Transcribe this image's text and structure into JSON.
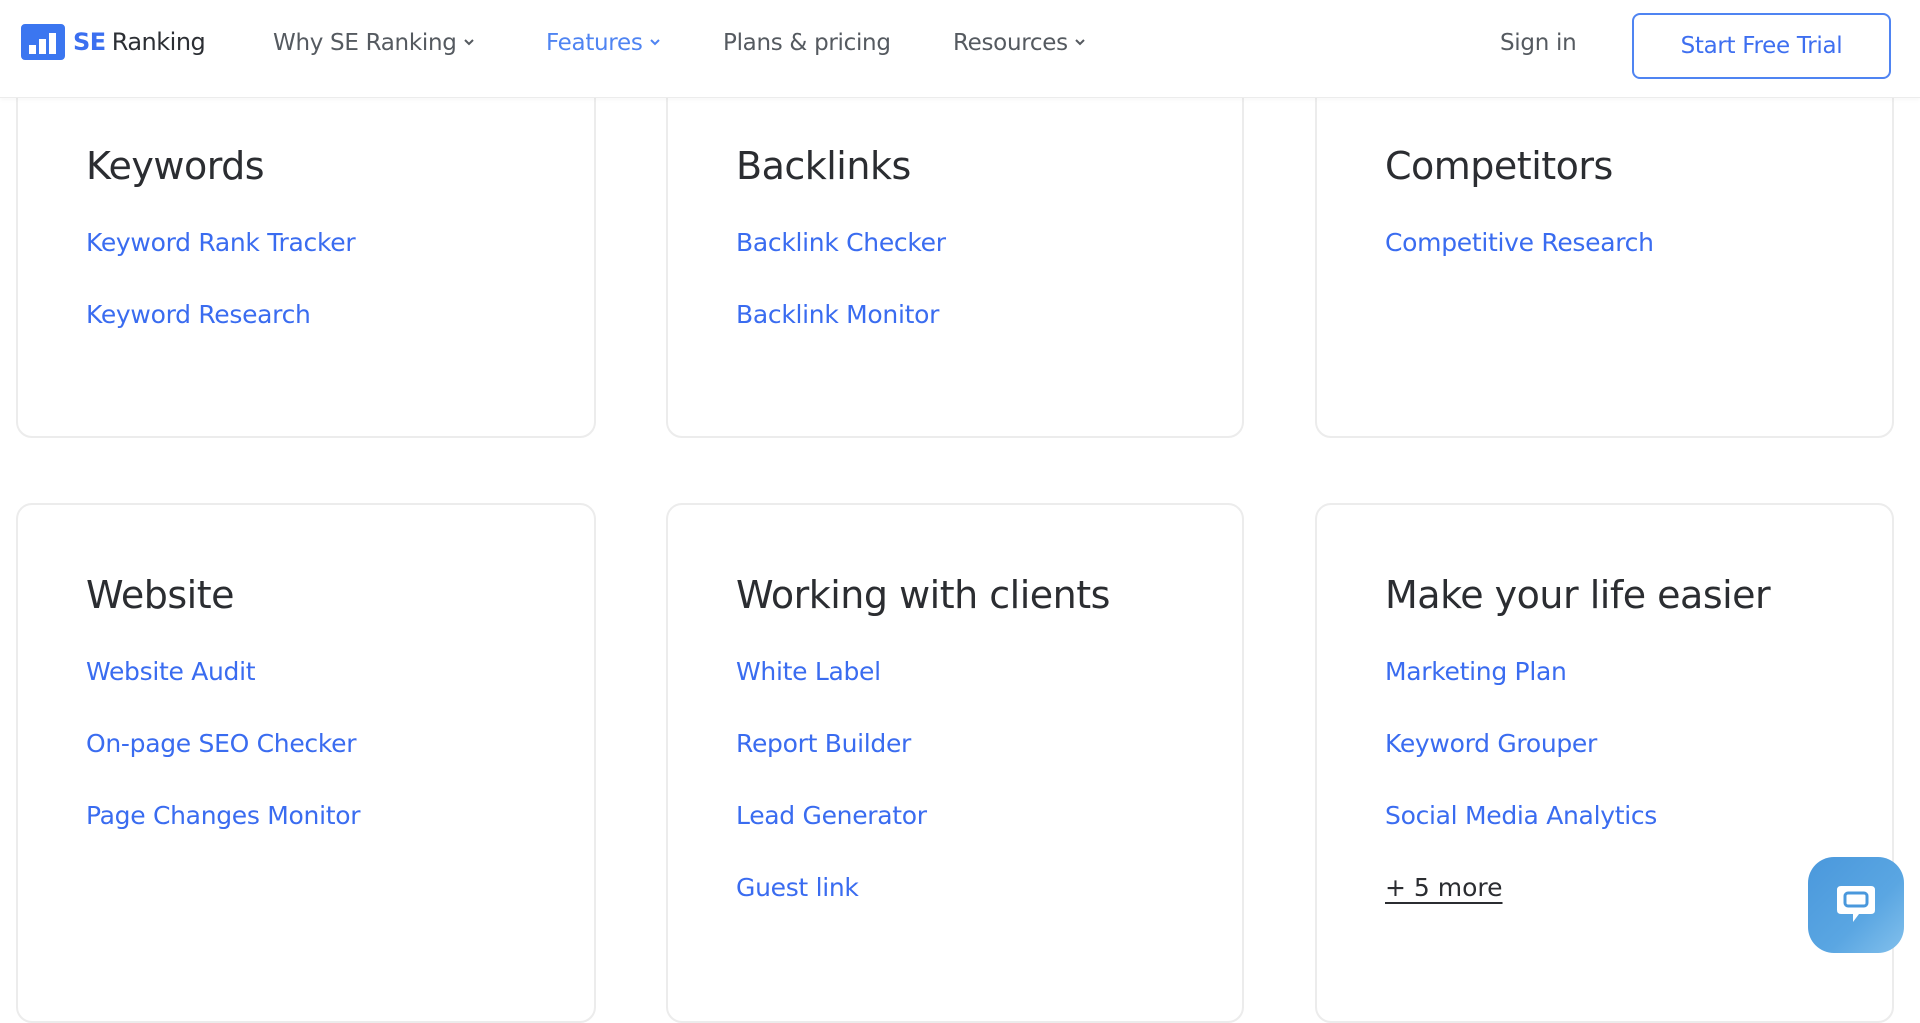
{
  "navbar": {
    "logo": {
      "se": "SE",
      "ranking": "Ranking"
    },
    "items": [
      {
        "label": "Why SE Ranking",
        "has_dropdown": true,
        "active": false
      },
      {
        "label": "Features",
        "has_dropdown": true,
        "active": true
      },
      {
        "label": "Plans & pricing",
        "has_dropdown": false,
        "active": false
      },
      {
        "label": "Resources",
        "has_dropdown": true,
        "active": false
      }
    ],
    "sign_in": "Sign in",
    "cta": "Start Free Trial"
  },
  "cards": [
    {
      "title": "Keywords",
      "links": [
        "Keyword Rank Tracker",
        "Keyword Research"
      ]
    },
    {
      "title": "Backlinks",
      "links": [
        "Backlink Checker",
        "Backlink Monitor"
      ]
    },
    {
      "title": "Competitors",
      "links": [
        "Competitive Research"
      ]
    },
    {
      "title": "Website",
      "links": [
        "Website Audit",
        "On-page SEO Checker",
        "Page Changes Monitor"
      ]
    },
    {
      "title": "Working with clients",
      "links": [
        "White Label",
        "Report Builder",
        "Lead Generator",
        "Guest link"
      ]
    },
    {
      "title": "Make your life easier",
      "links": [
        "Marketing Plan",
        "Keyword Grouper",
        "Social Media Analytics"
      ],
      "more": "+ 5 more"
    }
  ],
  "colors": {
    "accent": "#3a6cf0",
    "nav_active": "#4f84f2",
    "text_dark": "#2b2d31",
    "card_border": "#ececec",
    "chat_button": "#4a98dc"
  },
  "chat_widget": {
    "icon": "chat-bubble-icon"
  }
}
